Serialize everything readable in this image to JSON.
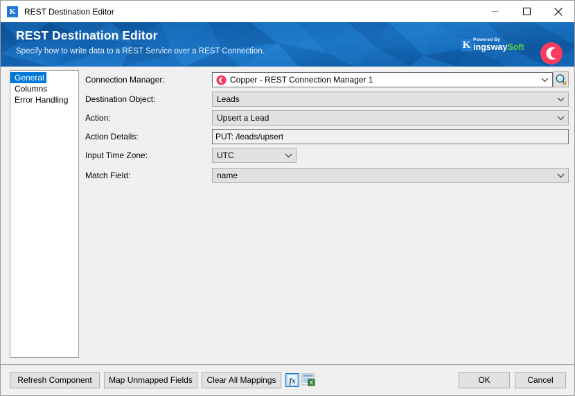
{
  "window": {
    "title": "REST Destination Editor",
    "icon": "kingswaysoft-k-icon",
    "controls": {
      "minimize": "minimize-icon",
      "maximize": "maximize-icon",
      "close": "close-icon"
    }
  },
  "banner": {
    "title": "REST Destination Editor",
    "subtitle": "Specify how to write data to a REST Service over a REST Connection.",
    "brand": {
      "powered_by": "Powered By",
      "k": "K",
      "word1": "ingsway",
      "word2": "Soft"
    },
    "product_logo": "copper-logo-icon",
    "colors": {
      "bg_dark": "#0d4f93",
      "bg_mid": "#1669b8",
      "bg_light": "#2d86d4",
      "brand_green": "#5fc63a",
      "brand_blue": "#1e7ad4",
      "copper_pink": "#fb3a5d"
    }
  },
  "sidebar": {
    "items": [
      {
        "label": "General",
        "selected": true
      },
      {
        "label": "Columns",
        "selected": false
      },
      {
        "label": "Error Handling",
        "selected": false
      }
    ]
  },
  "form": {
    "fields": [
      {
        "label": "Connection Manager:",
        "value": "Copper - REST Connection Manager 1",
        "type": "combobox-editable",
        "icon": "copper-connection-icon"
      },
      {
        "label": "Destination Object:",
        "value": "Leads",
        "type": "combobox"
      },
      {
        "label": "Action:",
        "value": "Upsert a Lead",
        "type": "combobox"
      },
      {
        "label": "Action Details:",
        "value": "PUT: /leads/upsert",
        "type": "textbox-readonly"
      },
      {
        "label": "Input Time Zone:",
        "value": "UTC",
        "type": "combobox-small"
      },
      {
        "label": "Match Field:",
        "value": "name",
        "type": "combobox"
      }
    ],
    "browse_button": "search-magnifier-icon"
  },
  "footer": {
    "buttons": [
      {
        "label": "Refresh Component"
      },
      {
        "label": "Map Unmapped Fields"
      },
      {
        "label": "Clear All Mappings"
      }
    ],
    "icon_buttons": [
      {
        "name": "expression-editor-icon",
        "label": "fx"
      },
      {
        "name": "export-grid-icon",
        "label": ""
      }
    ],
    "ok_label": "OK",
    "cancel_label": "Cancel"
  }
}
